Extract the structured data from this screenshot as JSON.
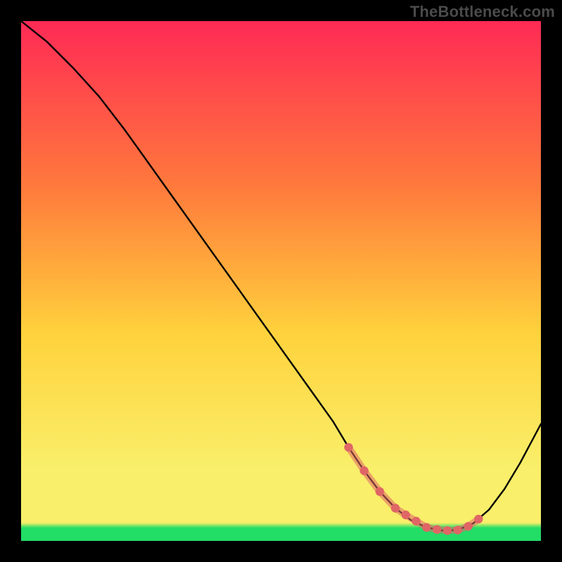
{
  "watermark": "TheBottleneck.com",
  "colors": {
    "bg": "#000000",
    "curve": "#000000",
    "marker": "#e06666",
    "grad_top": "#ff2a55",
    "grad_mid_upper": "#ff7a3c",
    "grad_mid": "#ffd23c",
    "grad_lower": "#f9ef6a",
    "grad_green": "#22dd66",
    "watermark_text": "#4b4b4b"
  },
  "chart_data": {
    "type": "line",
    "title": "",
    "xlabel": "",
    "ylabel": "",
    "xlim": [
      0,
      100
    ],
    "ylim": [
      0,
      100
    ],
    "series": [
      {
        "name": "bottleneck-curve",
        "x": [
          0,
          5,
          10,
          15,
          20,
          25,
          30,
          35,
          40,
          45,
          50,
          55,
          60,
          63,
          66,
          69,
          72,
          75,
          78,
          81,
          84,
          87,
          90,
          93,
          96,
          100
        ],
        "y": [
          100,
          96,
          91,
          85.5,
          79,
          72,
          65,
          58,
          51,
          44,
          37,
          30,
          23,
          18,
          13.5,
          9.5,
          6.3,
          4.0,
          2.6,
          2.0,
          2.1,
          3.4,
          6.0,
          10.0,
          15.0,
          22.5
        ]
      }
    ],
    "markers": {
      "name": "optimal-range",
      "x": [
        63,
        66,
        69,
        72,
        74,
        76,
        78,
        80,
        82,
        84,
        86,
        88
      ],
      "y": [
        18,
        13.5,
        9.5,
        6.3,
        5.0,
        3.8,
        2.6,
        2.2,
        2.0,
        2.1,
        2.8,
        4.2
      ]
    },
    "legend": [],
    "grid": false
  }
}
